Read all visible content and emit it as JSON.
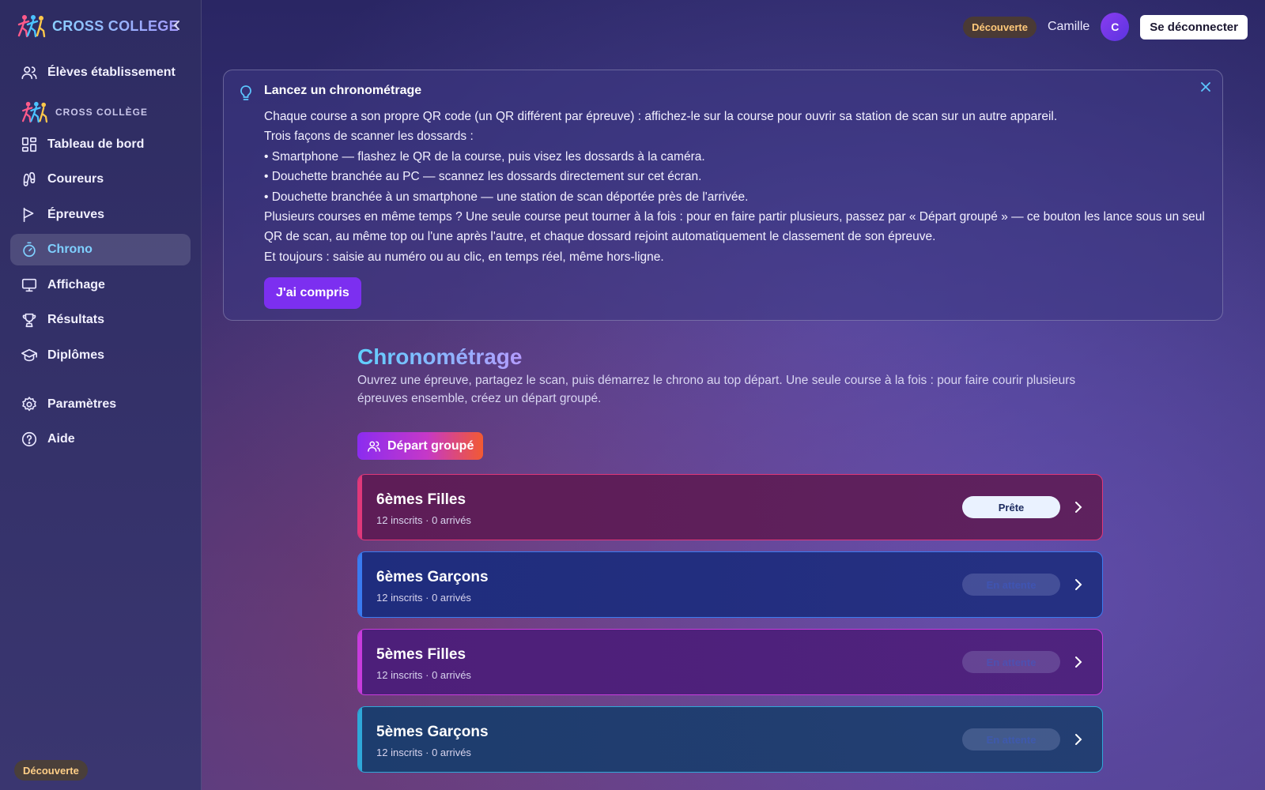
{
  "brand": {
    "name": "CROSS COLLEGE"
  },
  "sidebar": {
    "top_item": {
      "label": "Élèves établissement",
      "icon": "users-icon"
    },
    "section_label": "CROSS COLLÈGE",
    "items": [
      {
        "label": "Tableau de bord",
        "icon": "grid-icon"
      },
      {
        "label": "Coureurs",
        "icon": "footprints-icon"
      },
      {
        "label": "Épreuves",
        "icon": "flag-icon"
      },
      {
        "label": "Chrono",
        "icon": "stopwatch-icon",
        "active": true
      },
      {
        "label": "Affichage",
        "icon": "monitor-icon"
      },
      {
        "label": "Résultats",
        "icon": "trophy-icon"
      },
      {
        "label": "Diplômes",
        "icon": "graduation-cap-icon"
      }
    ],
    "bottom_items": [
      {
        "label": "Paramètres",
        "icon": "gear-icon"
      },
      {
        "label": "Aide",
        "icon": "help-icon"
      }
    ],
    "badge": "Découverte"
  },
  "topbar": {
    "badge": "Découverte",
    "user_name": "Camille",
    "avatar_initial": "C",
    "logout_label": "Se déconnecter"
  },
  "tip": {
    "title": "Lancez un chronométrage",
    "lines": [
      "Chaque course a son propre QR code (un QR différent par épreuve) : affichez-le sur la course pour ouvrir sa station de scan sur un autre appareil.",
      "Trois façons de scanner les dossards :",
      "• Smartphone — flashez le QR de la course, puis visez les dossards à la caméra.",
      "• Douchette branchée au PC — scannez les dossards directement sur cet écran.",
      "• Douchette branchée à un smartphone — une station de scan déportée près de l'arrivée.",
      "Plusieurs courses en même temps ? Une seule course peut tourner à la fois : pour en faire partir plusieurs, passez par « Départ groupé » — ce bouton les lance sous un seul QR de scan, au même top ou l'une après l'autre, et chaque dossard rejoint automatiquement le classement de son épreuve.",
      "Et toujours : saisie au numéro ou au clic, en temps réel, même hors-ligne."
    ],
    "button_label": "J'ai compris"
  },
  "page": {
    "title": "Chronométrage",
    "description": "Ouvrez une épreuve, partagez le scan, puis démarrez le chrono au top départ. Une seule course à la fois : pour faire courir plusieurs épreuves ensemble, créez un départ groupé.",
    "group_button_label": "Départ groupé"
  },
  "races": [
    {
      "name": "6èmes Filles",
      "meta": "12 inscrits · 0 arrivés",
      "status": "Prête",
      "ready": true,
      "accent": "#e0387a",
      "bg": "#5e1d57"
    },
    {
      "name": "6èmes Garçons",
      "meta": "12 inscrits · 0 arrivés",
      "status": "En attente",
      "ready": false,
      "accent": "#3a7bf0",
      "bg": "#1f2d7e"
    },
    {
      "name": "5èmes Filles",
      "meta": "12 inscrits · 0 arrivés",
      "status": "En attente",
      "ready": false,
      "accent": "#c83cdc",
      "bg": "#4d1f7a"
    },
    {
      "name": "5èmes Garçons",
      "meta": "12 inscrits · 0 arrivés",
      "status": "En attente",
      "ready": false,
      "accent": "#2fa8d8",
      "bg": "#1d3d6e"
    }
  ]
}
